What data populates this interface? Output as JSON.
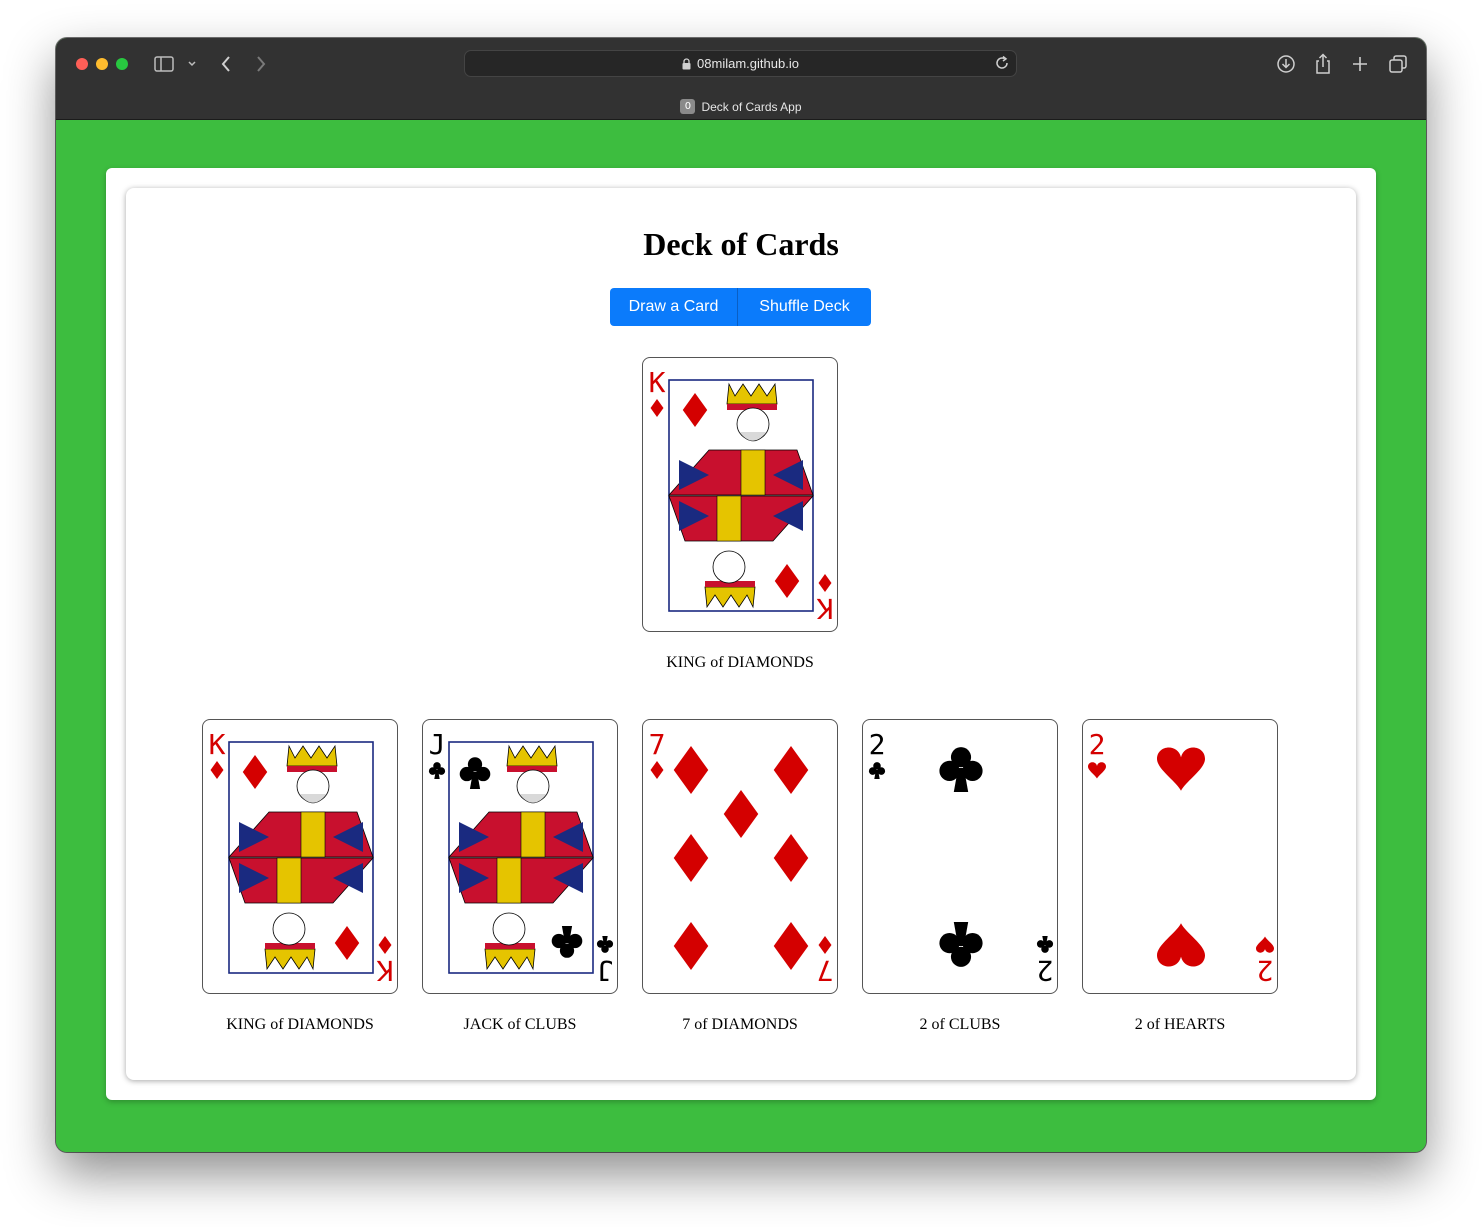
{
  "browser": {
    "url": "08milam.github.io",
    "tab_title": "Deck of Cards App",
    "tab_badge": "0"
  },
  "page": {
    "title": "Deck of Cards",
    "draw_label": "Draw a Card",
    "shuffle_label": "Shuffle Deck"
  },
  "current_card": {
    "rank": "K",
    "suit": "diamonds",
    "label": "KING of DIAMONDS"
  },
  "drawn_cards": [
    {
      "rank": "K",
      "suit": "diamonds",
      "label": "KING of DIAMONDS"
    },
    {
      "rank": "J",
      "suit": "clubs",
      "label": "JACK of CLUBS"
    },
    {
      "rank": "7",
      "suit": "diamonds",
      "label": "7 of DIAMONDS"
    },
    {
      "rank": "2",
      "suit": "clubs",
      "label": "2 of CLUBS"
    },
    {
      "rank": "2",
      "suit": "hearts",
      "label": "2 of HEARTS"
    }
  ],
  "colors": {
    "page_bg": "#3dbd3f",
    "button": "#0b7bfb",
    "red_suit": "#d40000",
    "black_suit": "#000000"
  }
}
